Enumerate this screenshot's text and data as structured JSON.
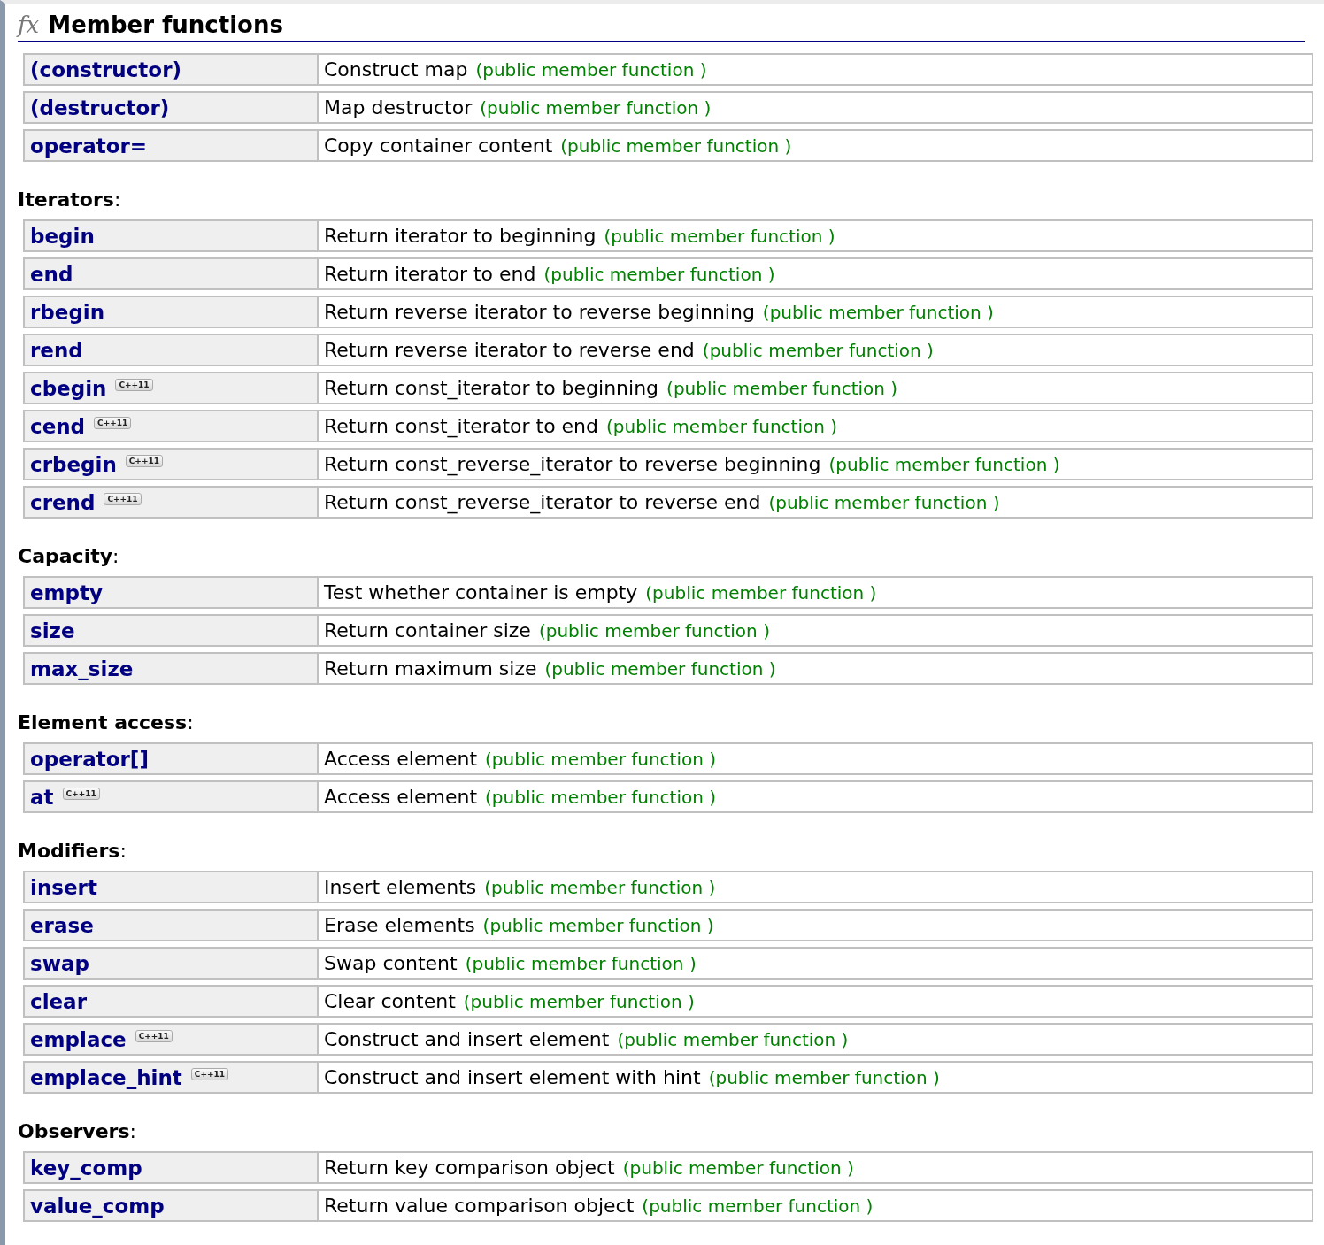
{
  "section": {
    "symbol": "fx",
    "title": "Member functions"
  },
  "groups": [
    {
      "rows": [
        {
          "name": "(constructor)",
          "description": "Construct map",
          "note": "(public member function )"
        },
        {
          "name": "(destructor)",
          "description": "Map destructor",
          "note": "(public member function )"
        },
        {
          "name": "operator=",
          "description": "Copy container content",
          "note": "(public member function )"
        }
      ]
    },
    {
      "heading": "**Iterators**:",
      "rows": [
        {
          "name": "begin",
          "description": "Return iterator to beginning",
          "note": "(public member function )"
        },
        {
          "name": "end",
          "description": "Return iterator to end",
          "note": "(public member function )"
        },
        {
          "name": "rbegin",
          "description": "Return reverse iterator to reverse beginning",
          "note": "(public member function )"
        },
        {
          "name": "rend",
          "description": "Return reverse iterator to reverse end",
          "note": "(public member function )"
        },
        {
          "name": "cbegin",
          "badge": "C++11",
          "description": "Return const_iterator to beginning",
          "note": "(public member function )"
        },
        {
          "name": "cend",
          "badge": "C++11",
          "description": "Return const_iterator to end",
          "note": "(public member function )"
        },
        {
          "name": "crbegin",
          "badge": "C++11",
          "description": "Return const_reverse_iterator to reverse beginning",
          "note": "(public member function )"
        },
        {
          "name": "crend",
          "badge": "C++11",
          "description": "Return const_reverse_iterator to reverse end",
          "note": "(public member function )"
        }
      ]
    },
    {
      "heading": "**Capacity**:",
      "rows": [
        {
          "name": "empty",
          "description": "Test whether container is empty",
          "note": "(public member function )"
        },
        {
          "name": "size",
          "description": "Return container size",
          "note": "(public member function )"
        },
        {
          "name": "max_size",
          "description": "Return maximum size",
          "note": "(public member function )"
        }
      ]
    },
    {
      "heading": "**Element access**:",
      "rows": [
        {
          "name": "operator[]",
          "description": "Access element",
          "note": "(public member function )"
        },
        {
          "name": "at",
          "badge": "C++11",
          "description": "Access element",
          "note": "(public member function )"
        }
      ]
    },
    {
      "heading": "**Modifiers**:",
      "rows": [
        {
          "name": "insert",
          "description": "Insert elements",
          "note": "(public member function )"
        },
        {
          "name": "erase",
          "description": "Erase elements",
          "note": "(public member function )"
        },
        {
          "name": "swap",
          "description": "Swap content",
          "note": "(public member function )"
        },
        {
          "name": "clear",
          "description": "Clear content",
          "note": "(public member function )"
        },
        {
          "name": "emplace",
          "badge": "C++11",
          "description": "Construct and insert element",
          "note": "(public member function )"
        },
        {
          "name": "emplace_hint",
          "badge": "C++11",
          "description": "Construct and insert element with hint",
          "note": "(public member function )"
        }
      ]
    },
    {
      "heading": "**Observers**:",
      "rows": [
        {
          "name": "key_comp",
          "description": "Return key comparison object",
          "note": "(public member function )"
        },
        {
          "name": "value_comp",
          "description": "Return value comparison object",
          "note": "(public member function )"
        }
      ]
    }
  ]
}
